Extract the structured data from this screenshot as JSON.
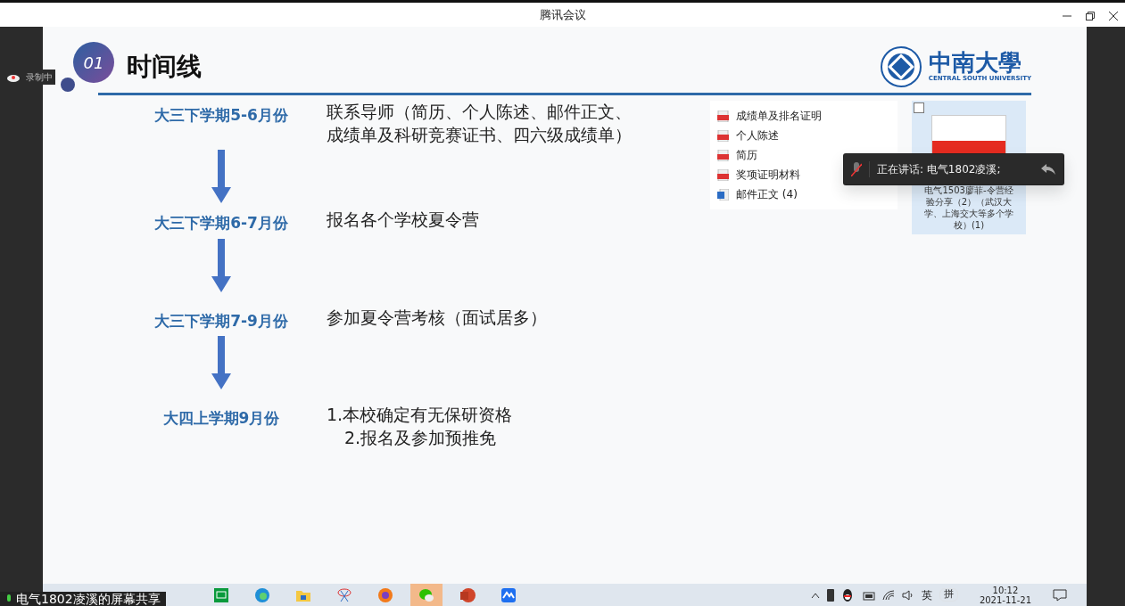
{
  "window": {
    "title": "腾讯会议"
  },
  "recording": {
    "label": "录制中"
  },
  "slide": {
    "number": "01",
    "title": "时间线",
    "logo": {
      "name": "中南大學",
      "subtitle": "CENTRAL SOUTH UNIVERSITY"
    },
    "timeline": [
      {
        "period": "大三下学期5-6月份",
        "lines": [
          "联系导师（简历、个人陈述、邮件正文、",
          "成绩单及科研竞赛证书、四六级成绩单）"
        ]
      },
      {
        "period": "大三下学期6-7月份",
        "lines": [
          "报名各个学校夏令营"
        ]
      },
      {
        "period": "大三下学期7-9月份",
        "lines": [
          "参加夏令营考核（面试居多）"
        ]
      },
      {
        "period": "大四上学期9月份",
        "lines": [
          "1.本校确定有无保研资格",
          "2.报名及参加预推免"
        ]
      }
    ],
    "files": [
      {
        "name": "成绩单及排名证明",
        "kind": "pdf"
      },
      {
        "name": "个人陈述",
        "kind": "pdf"
      },
      {
        "name": "简历",
        "kind": "pdf"
      },
      {
        "name": "奖项证明材料",
        "kind": "pdf"
      },
      {
        "name": "邮件正文 (4)",
        "kind": "word"
      }
    ],
    "pdf_file": {
      "checked": false,
      "lines": [
        "电气1503廖菲-令营经",
        "验分享（2）（武汉大",
        "学、上海交大等多个学",
        "校）(1)"
      ]
    }
  },
  "speaking_toast": {
    "label": "正在讲话: 电气1802凌溪;",
    "muted": true
  },
  "share_label": "电气1802凌溪的屏幕共享",
  "taskbar": {
    "apps": [
      {
        "kind": "tv",
        "selected": false
      },
      {
        "kind": "browser",
        "selected": false
      },
      {
        "kind": "folder",
        "selected": false
      },
      {
        "kind": "scissors",
        "selected": false
      },
      {
        "kind": "fox",
        "selected": false
      },
      {
        "kind": "chat",
        "selected": true
      },
      {
        "kind": "slides",
        "selected": false
      },
      {
        "kind": "meeting",
        "selected": false
      }
    ],
    "input_mode": "英",
    "ime": "拼",
    "time": "10:12",
    "date": "2021-11-21"
  }
}
